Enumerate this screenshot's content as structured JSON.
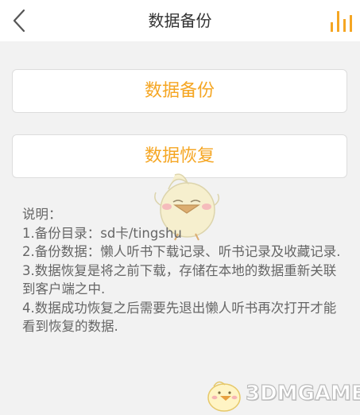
{
  "header": {
    "title": "数据备份",
    "back_icon": "chevron-left-icon",
    "right_icon": "bar-chart-icon"
  },
  "actions": {
    "backup_label": "数据备份",
    "restore_label": "数据恢复"
  },
  "notes": {
    "heading": "说明：",
    "line1": "1.备份目录：sd卡/tingshu",
    "line2": "2.备份数据：懒人听书下载记录、听书记录及收藏记录.",
    "line3": "3.数据恢复是将之前下载，存储在本地的数据重新关联到客户端之中.",
    "line4": "4.数据成功恢复之后需要先退出懒人听书再次打开才能看到恢复的数据."
  },
  "watermark": {
    "text": "3DMGAME"
  },
  "colors": {
    "accent": "#f5a623",
    "title_text": "#333333",
    "notes_text": "#666666",
    "background": "#f2f2f2"
  }
}
